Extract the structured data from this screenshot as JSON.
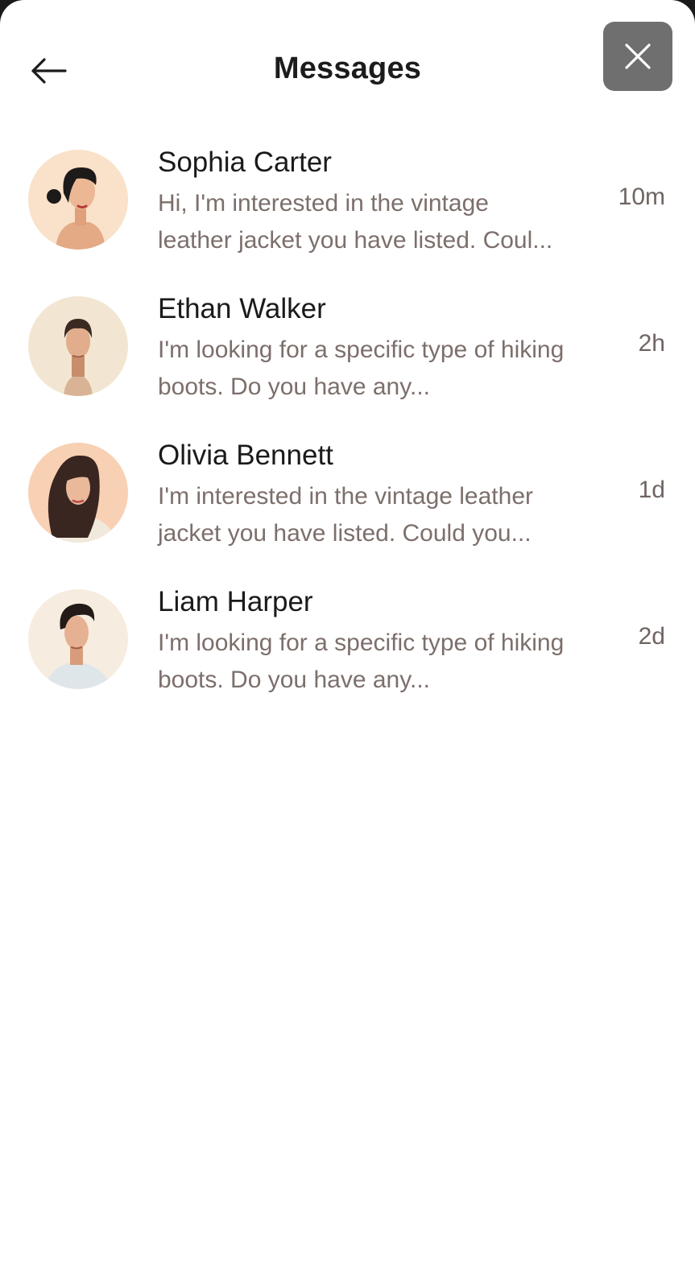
{
  "header": {
    "title": "Messages",
    "back_icon": "arrow-left-icon",
    "close_icon": "close-icon",
    "close_button_color": "#6f6f6f"
  },
  "conversations": [
    {
      "name": "Sophia Carter",
      "preview_line1": "Hi, I'm interested in the vintage",
      "preview_line2": "leather jacket you have listed. Coul...",
      "time": "10m"
    },
    {
      "name": "Ethan Walker",
      "preview_line1": "I'm looking for a specific type of hiking",
      "preview_line2": "boots. Do you have any...",
      "time": "2h"
    },
    {
      "name": "Olivia Bennett",
      "preview_line1": "I'm interested in the vintage leather",
      "preview_line2": "jacket you have listed. Could you...",
      "time": "1d"
    },
    {
      "name": "Liam Harper",
      "preview_line1": "I'm looking for a specific type of hiking",
      "preview_line2": "boots. Do you have any...",
      "time": "2d"
    }
  ]
}
